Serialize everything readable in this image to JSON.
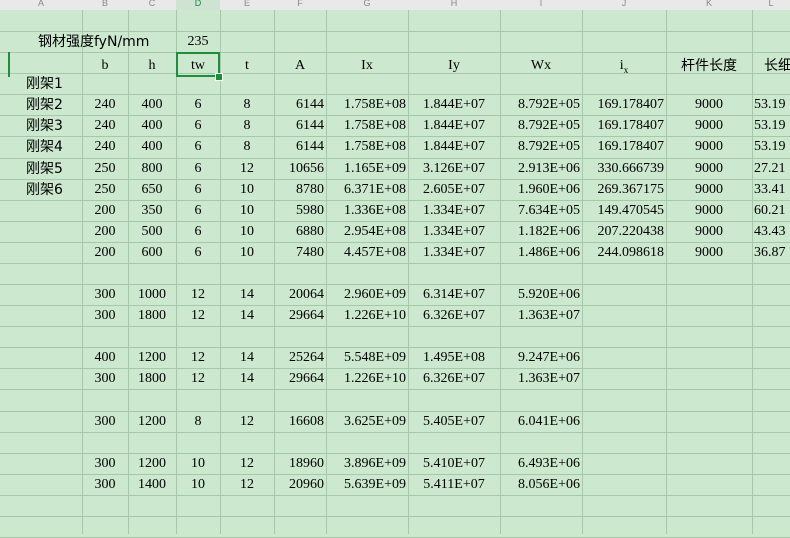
{
  "column_headers": [
    "A",
    "B",
    "C",
    "D",
    "E",
    "F",
    "G",
    "H",
    "I",
    "J",
    "K",
    "L"
  ],
  "active_column": "D",
  "steel_strength": {
    "label": "钢材强度fyN/mm",
    "value": "235"
  },
  "headers": {
    "b": "b",
    "h": "h",
    "tw": "tw",
    "t": "t",
    "A": "A",
    "Ix": "Ix",
    "Iy": "Iy",
    "Wx": "Wx",
    "i": "i",
    "i_sub": "x",
    "length": "杆件长度",
    "slender": "长细"
  },
  "frames": [
    "刚架1",
    "刚架2",
    "刚架3",
    "刚架4",
    "刚架5",
    "刚架6"
  ],
  "rows": [
    {
      "b": "240",
      "h": "400",
      "tw": "6",
      "t": "8",
      "A": "6144",
      "Ix": "1.758E+08",
      "Iy": "1.844E+07",
      "Wx": "8.792E+05",
      "i": "169.178407",
      "L": "9000",
      "lam": "53.19"
    },
    {
      "b": "240",
      "h": "400",
      "tw": "6",
      "t": "8",
      "A": "6144",
      "Ix": "1.758E+08",
      "Iy": "1.844E+07",
      "Wx": "8.792E+05",
      "i": "169.178407",
      "L": "9000",
      "lam": "53.19"
    },
    {
      "b": "240",
      "h": "400",
      "tw": "6",
      "t": "8",
      "A": "6144",
      "Ix": "1.758E+08",
      "Iy": "1.844E+07",
      "Wx": "8.792E+05",
      "i": "169.178407",
      "L": "9000",
      "lam": "53.19"
    },
    {
      "b": "250",
      "h": "800",
      "tw": "6",
      "t": "12",
      "A": "10656",
      "Ix": "1.165E+09",
      "Iy": "3.126E+07",
      "Wx": "2.913E+06",
      "i": "330.666739",
      "L": "9000",
      "lam": "27.21"
    },
    {
      "b": "250",
      "h": "650",
      "tw": "6",
      "t": "10",
      "A": "8780",
      "Ix": "6.371E+08",
      "Iy": "2.605E+07",
      "Wx": "1.960E+06",
      "i": "269.367175",
      "L": "9000",
      "lam": "33.41"
    },
    {
      "b": "200",
      "h": "350",
      "tw": "6",
      "t": "10",
      "A": "5980",
      "Ix": "1.336E+08",
      "Iy": "1.334E+07",
      "Wx": "7.634E+05",
      "i": "149.470545",
      "L": "9000",
      "lam": "60.21"
    },
    {
      "b": "200",
      "h": "500",
      "tw": "6",
      "t": "10",
      "A": "6880",
      "Ix": "2.954E+08",
      "Iy": "1.334E+07",
      "Wx": "1.182E+06",
      "i": "207.220438",
      "L": "9000",
      "lam": "43.43"
    },
    {
      "b": "200",
      "h": "600",
      "tw": "6",
      "t": "10",
      "A": "7480",
      "Ix": "4.457E+08",
      "Iy": "1.334E+07",
      "Wx": "1.486E+06",
      "i": "244.098618",
      "L": "9000",
      "lam": "36.87"
    },
    null,
    {
      "b": "300",
      "h": "1000",
      "tw": "12",
      "t": "14",
      "A": "20064",
      "Ix": "2.960E+09",
      "Iy": "6.314E+07",
      "Wx": "5.920E+06"
    },
    {
      "b": "300",
      "h": "1800",
      "tw": "12",
      "t": "14",
      "A": "29664",
      "Ix": "1.226E+10",
      "Iy": "6.326E+07",
      "Wx": "1.363E+07"
    },
    null,
    {
      "b": "400",
      "h": "1200",
      "tw": "12",
      "t": "14",
      "A": "25264",
      "Ix": "5.548E+09",
      "Iy": "1.495E+08",
      "Wx": "9.247E+06"
    },
    {
      "b": "300",
      "h": "1800",
      "tw": "12",
      "t": "14",
      "A": "29664",
      "Ix": "1.226E+10",
      "Iy": "6.326E+07",
      "Wx": "1.363E+07"
    },
    null,
    {
      "b": "300",
      "h": "1200",
      "tw": "8",
      "t": "12",
      "A": "16608",
      "Ix": "3.625E+09",
      "Iy": "5.405E+07",
      "Wx": "6.041E+06"
    },
    null,
    {
      "b": "300",
      "h": "1200",
      "tw": "10",
      "t": "12",
      "A": "18960",
      "Ix": "3.896E+09",
      "Iy": "5.410E+07",
      "Wx": "6.493E+06"
    },
    {
      "b": "300",
      "h": "1400",
      "tw": "10",
      "t": "12",
      "A": "20960",
      "Ix": "5.639E+09",
      "Iy": "5.411E+07",
      "Wx": "8.056E+06"
    }
  ]
}
